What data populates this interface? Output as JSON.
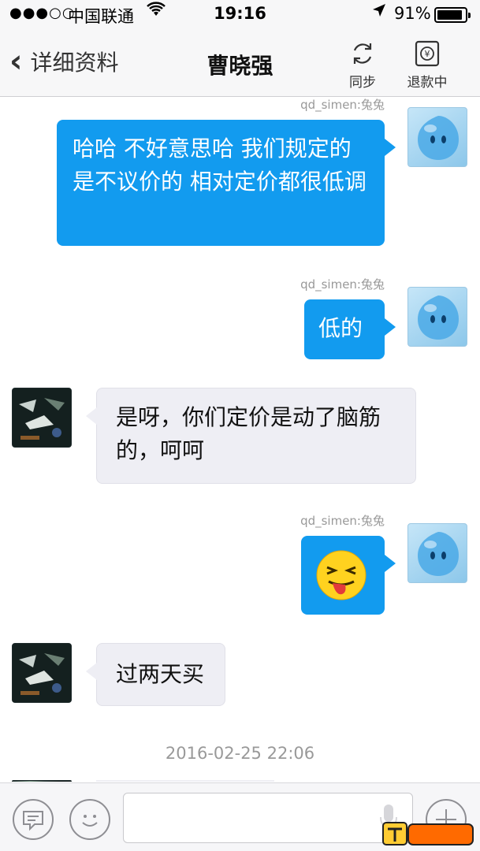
{
  "status_bar": {
    "signal": "●●●○○",
    "carrier": "中国联通",
    "time": "19:16",
    "battery_text": "91%",
    "battery_level": 0.91
  },
  "nav": {
    "back_label": "详细资料",
    "title": "曹晓强",
    "sync_label": "同步",
    "refund_label": "退款中"
  },
  "messages": [
    {
      "sender": "qd_simen:兔兔",
      "text": "哈哈 不好意思哈 我们规定的是不议价的 相对定价都很低调"
    },
    {
      "sender": "qd_simen:兔兔",
      "text": "低的"
    },
    {
      "text": "是呀，你们定价是动了脑筋的，呵呵"
    },
    {
      "sender": "qd_simen:兔兔",
      "emoji": "tongue-out-emoji"
    },
    {
      "text": "过两天买"
    }
  ],
  "timestamp": "2016-02-25 22:06",
  "input": {
    "placeholder": ""
  },
  "colors": {
    "accent": "#129bef",
    "incoming_bubble": "#eeeef4"
  }
}
